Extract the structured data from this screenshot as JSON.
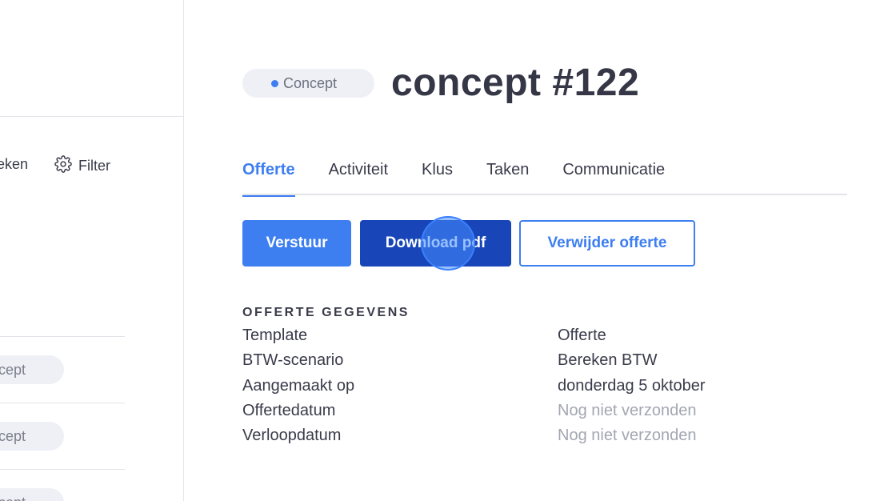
{
  "sidebar": {
    "search_label": "eken",
    "filter_label": "Filter",
    "rows": [
      {
        "badge": "cept"
      },
      {
        "badge": "cept"
      },
      {
        "badge": "cept"
      }
    ]
  },
  "header": {
    "status": "Concept",
    "title": "concept #122"
  },
  "tabs": [
    {
      "label": "Offerte",
      "active": true
    },
    {
      "label": "Activiteit",
      "active": false
    },
    {
      "label": "Klus",
      "active": false
    },
    {
      "label": "Taken",
      "active": false
    },
    {
      "label": "Communicatie",
      "active": false
    }
  ],
  "actions": {
    "send_label": "Verstuur",
    "download_label": "Download pdf",
    "delete_label": "Verwijder offerte"
  },
  "details": {
    "section_title": "OFFERTE GEGEVENS",
    "rows": [
      {
        "label": "Template",
        "value": "Offerte",
        "muted": false
      },
      {
        "label": "BTW-scenario",
        "value": "Bereken BTW",
        "muted": false
      },
      {
        "label": "Aangemaakt op",
        "value": "donderdag 5 oktober",
        "muted": false
      },
      {
        "label": "Offertedatum",
        "value": "Nog niet verzonden",
        "muted": true
      },
      {
        "label": "Verloopdatum",
        "value": "Nog niet verzonden",
        "muted": true
      }
    ]
  },
  "colors": {
    "accent": "#3d7ef0",
    "accent_dark": "#1846b8",
    "muted_text": "#a3a6b2",
    "pill_bg": "#eef0f5"
  }
}
